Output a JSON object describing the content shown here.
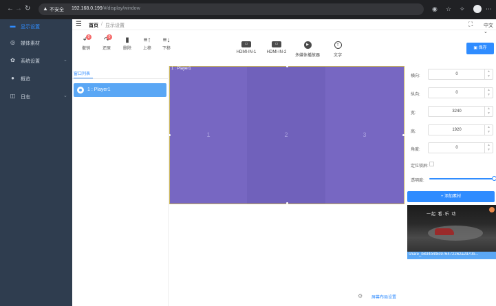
{
  "browser": {
    "insecure_label": "不安全",
    "url_host": "192.168.0.199",
    "url_path": "/#/display/window"
  },
  "sidebar": {
    "items": [
      {
        "label": "显示设置",
        "icon": "monitor-icon",
        "active": true
      },
      {
        "label": "媒体素材",
        "icon": "media-icon"
      },
      {
        "label": "系统设置",
        "icon": "gear-icon"
      },
      {
        "label": "概览",
        "icon": "info-icon"
      },
      {
        "label": "日志",
        "icon": "log-icon"
      }
    ]
  },
  "header": {
    "breadcrumb_home": "首页",
    "breadcrumb_current": "显示设置",
    "language": "中文"
  },
  "toolbar": {
    "undo_label": "撤销",
    "undo_count": "0",
    "redo_label": "还原",
    "redo_count": "0",
    "delete_label": "删除",
    "move_up_label": "上移",
    "move_down_label": "下移"
  },
  "sources": [
    {
      "label": "HDMI-IN-1",
      "icon": "hdmi-icon"
    },
    {
      "label": "HDMI-IN-2",
      "icon": "hdmi-icon"
    },
    {
      "label": "多媒体播放器",
      "icon": "play-icon"
    },
    {
      "label": "文字",
      "icon": "text-icon"
    }
  ],
  "save_label": "保存",
  "window_list": {
    "tab_label": "窗口列表",
    "items": [
      {
        "label": "1 : Player1"
      }
    ]
  },
  "canvas": {
    "title": "1 : Player1",
    "panels": [
      "1",
      "2",
      "3"
    ],
    "screen_layout_link": "屏幕布局设置"
  },
  "properties": {
    "x_label": "横向:",
    "x_value": "0",
    "y_label": "纵向:",
    "y_value": "0",
    "width_label": "宽:",
    "width_value": "3240",
    "height_label": "高:",
    "height_value": "1920",
    "angle_label": "角度:",
    "angle_value": "0",
    "lock_ratio_label": "定位锁屏:",
    "opacity_label": "透明度:",
    "opacity": 1.0,
    "add_material_label": "+ 添加素材"
  },
  "media": {
    "filename": "share_b834b4f8c976472262a2d70b...",
    "thumbnail_title": "一起 看·乐 动"
  },
  "colors": {
    "accent": "#2f8cff",
    "sidebar_bg": "#2f3d4f",
    "canvas_bg": "#7766c0",
    "selected_item": "#5aa7f5",
    "badge": "#f56c6c"
  }
}
